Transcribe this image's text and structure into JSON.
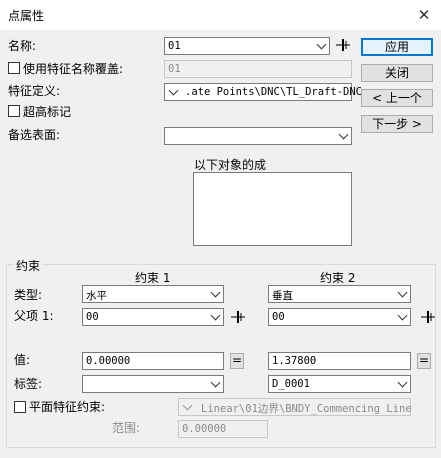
{
  "window": {
    "title": "点属性",
    "close_glyph": "✕"
  },
  "name": {
    "label": "名称:",
    "value": "01"
  },
  "override": {
    "label": "使用特征名称覆盖:",
    "value": "01",
    "checked": false
  },
  "feature_def": {
    "label": "特征定义:",
    "value": ".ate Points\\DNC\\TL_Draft-DNC"
  },
  "elevation_marker": {
    "label": "超高标记",
    "checked": false
  },
  "alt_surface": {
    "label": "备选表面:",
    "value": ""
  },
  "objects_box": {
    "label": "以下对象的成"
  },
  "buttons": {
    "apply": "应用",
    "close": "关闭",
    "prev": "< 上一个",
    "next": "下一步 >"
  },
  "constraints": {
    "group_label": "约束",
    "col1_header": "约束 1",
    "col2_header": "约束 2",
    "type_label": "类型:",
    "parent_label": "父项 1:",
    "value_label": "值:",
    "tag_label": "标签:",
    "plane_label": "平面特征约束:",
    "range_label": "范围:",
    "c1": {
      "type": "水平",
      "parent": "00",
      "value": "0.00000",
      "tag": ""
    },
    "c2": {
      "type": "垂直",
      "parent": "00",
      "value": "1.37800",
      "tag": "D_0001"
    },
    "eq_glyph": "=",
    "plane": {
      "checked": false,
      "value": "Linear\\01边界\\BNDY_Commencing Line",
      "range": "0.00000"
    }
  },
  "icons": {
    "pick": "crosshair-pick-icon"
  }
}
